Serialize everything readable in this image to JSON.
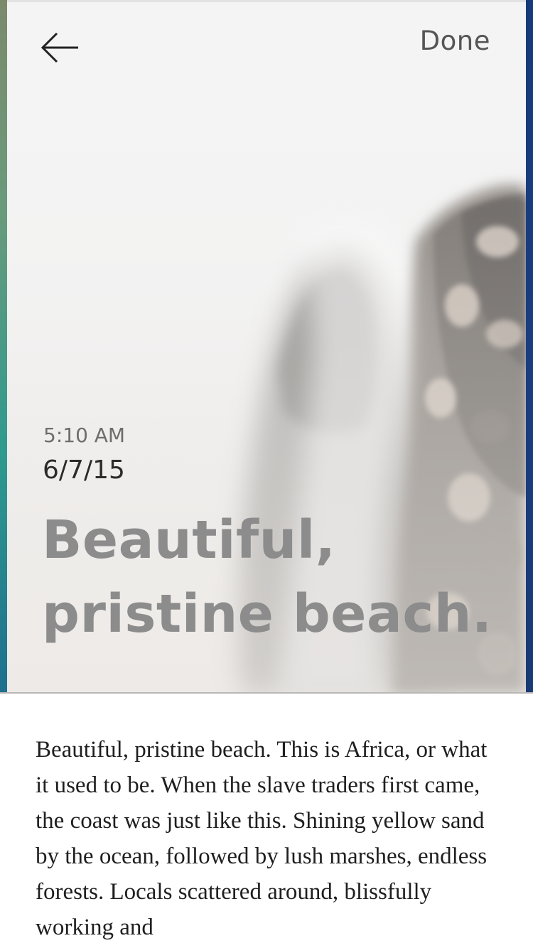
{
  "header": {
    "back_icon": "arrow-left-icon",
    "done_label": "Done"
  },
  "entry": {
    "time": "5:10 AM",
    "date": "6/7/15",
    "title": "Beautiful, pristine beach.",
    "body": "Beautiful, pristine beach. This is Africa, or what it used to be. When the slave traders first came, the coast was just like this. Shining yellow sand by the ocean, followed by lush marshes, endless forests. Locals scattered around, blissfully working and"
  },
  "colors": {
    "title": "#8c8c8c",
    "done": "#555555",
    "body_text": "#1f1f1f",
    "edge_right": "#1b3d7f"
  }
}
